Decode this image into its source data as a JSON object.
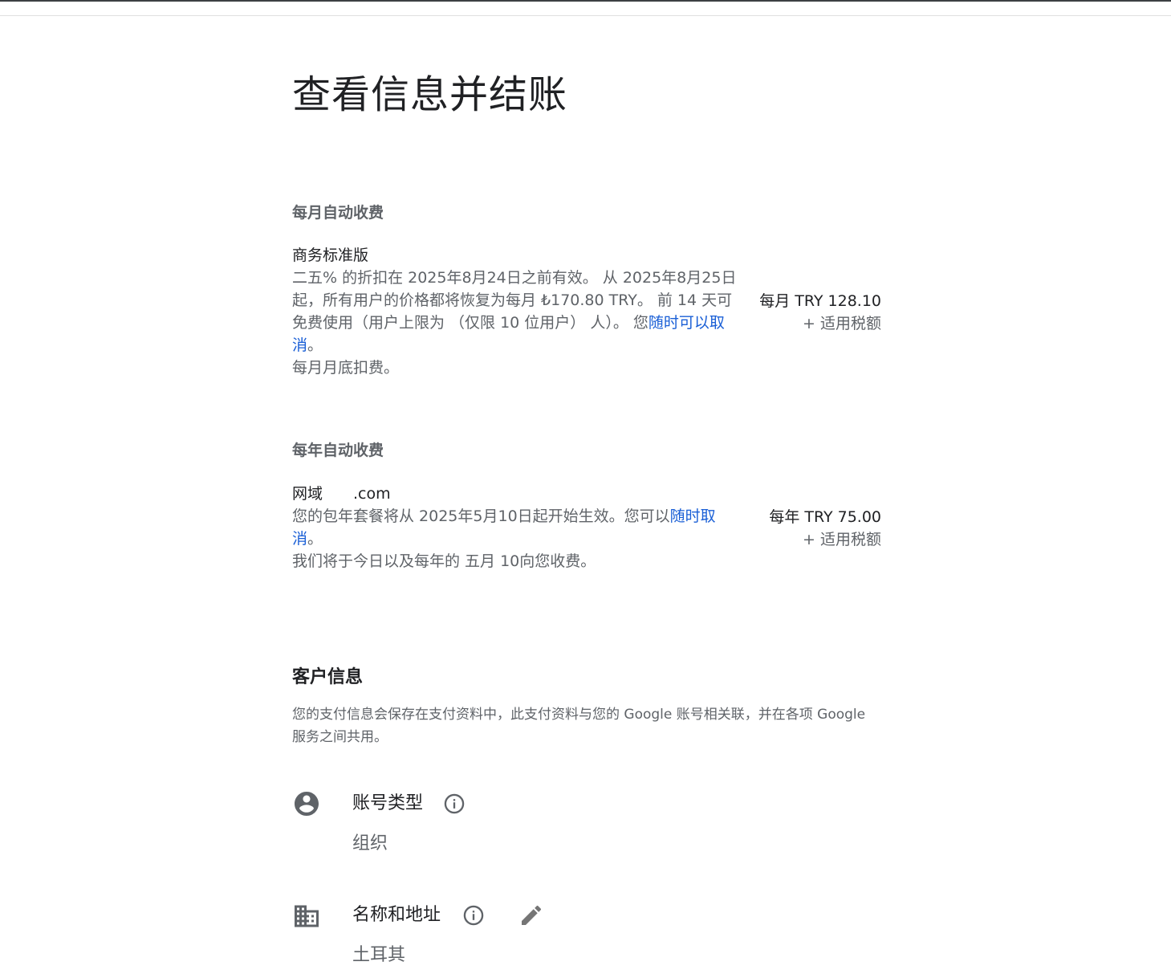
{
  "page_title": "查看信息并结账",
  "monthly": {
    "heading": "每月自动收费",
    "item_name": "商务标准版",
    "description_a": "二五% 的折扣在 2025年8月24日之前有效。 从 2025年8月25日起，所有用户的价格都将恢复为每月 ₺170.80 TRY。 前 14 天可免费使用（用户上限为 （仅限 10 位用户） 人）。 您",
    "cancel_link": "随时可以取消",
    "description_b": "。",
    "billing_note": "每月月底扣费。",
    "price": "每月 TRY 128.10",
    "tax": "+ 适用税额"
  },
  "annual": {
    "heading": "每年自动收费",
    "item_name_prefix": "网域",
    "item_name_suffix": ".com",
    "description_a": "您的包年套餐将从 2025年5月10日起开始生效。您可以",
    "cancel_link": "随时取消",
    "description_b": "。",
    "billing_note": "我们将于今日以及每年的 五月 10向您收费。",
    "price": "每年 TRY 75.00",
    "tax": "+ 适用税额"
  },
  "customer": {
    "heading": "客户信息",
    "description": "您的支付信息会保存在支付资料中，此支付资料与您的 Google 账号相关联，并在各项 Google 服务之间共用。",
    "account_type": {
      "label": "账号类型",
      "value": "组织",
      "icon": "account-circle-icon"
    },
    "name_address": {
      "label": "名称和地址",
      "value": "土耳其",
      "icon": "business-icon"
    }
  },
  "colors": {
    "link": "#1a5fd6",
    "text_primary": "#202124",
    "text_secondary": "#5f6368"
  }
}
